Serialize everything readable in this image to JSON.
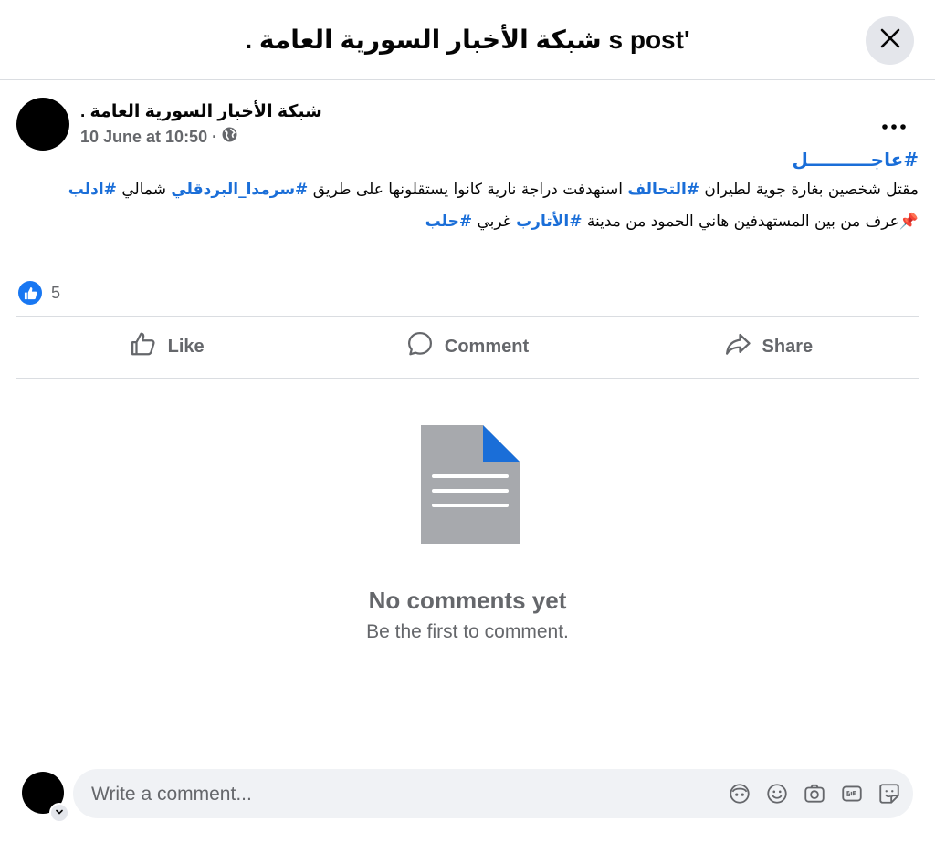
{
  "header": {
    "title": "'s post شبكة الأخبار السورية العامة ."
  },
  "post": {
    "author": "شبكة الأخبار السورية العامة .",
    "date": "10 June at 10:50",
    "separator": "·",
    "urgent_tag": "#عاجــــــــــل",
    "line1_text": "مقتل شخصين بغارة جوية لطيران ",
    "line1_tag1": "#التحالف",
    "line1_mid": " استهدفت دراجة نارية كانوا يستقلونها على طريق ",
    "line1_tag2": "#سرمدا_البردقلي",
    "line1_end": " شمالي ",
    "line1_tag3": "#ادلب",
    "line2_pin": "📌",
    "line2_text": "عرف من بين المستهدفين هاني الحمود من مدينة ",
    "line2_tag1": "#الأتارب",
    "line2_mid": " غربي ",
    "line2_tag2": "#حلب",
    "reaction_count": "5"
  },
  "actions": {
    "like": "Like",
    "comment": "Comment",
    "share": "Share"
  },
  "empty_state": {
    "title": "No comments yet",
    "subtitle": "Be the first to comment."
  },
  "composer": {
    "placeholder": "Write a comment..."
  },
  "colors": {
    "link": "#1a6ed8",
    "facebook_blue": "#1877f2",
    "doc_gray": "#a7a9ad"
  }
}
